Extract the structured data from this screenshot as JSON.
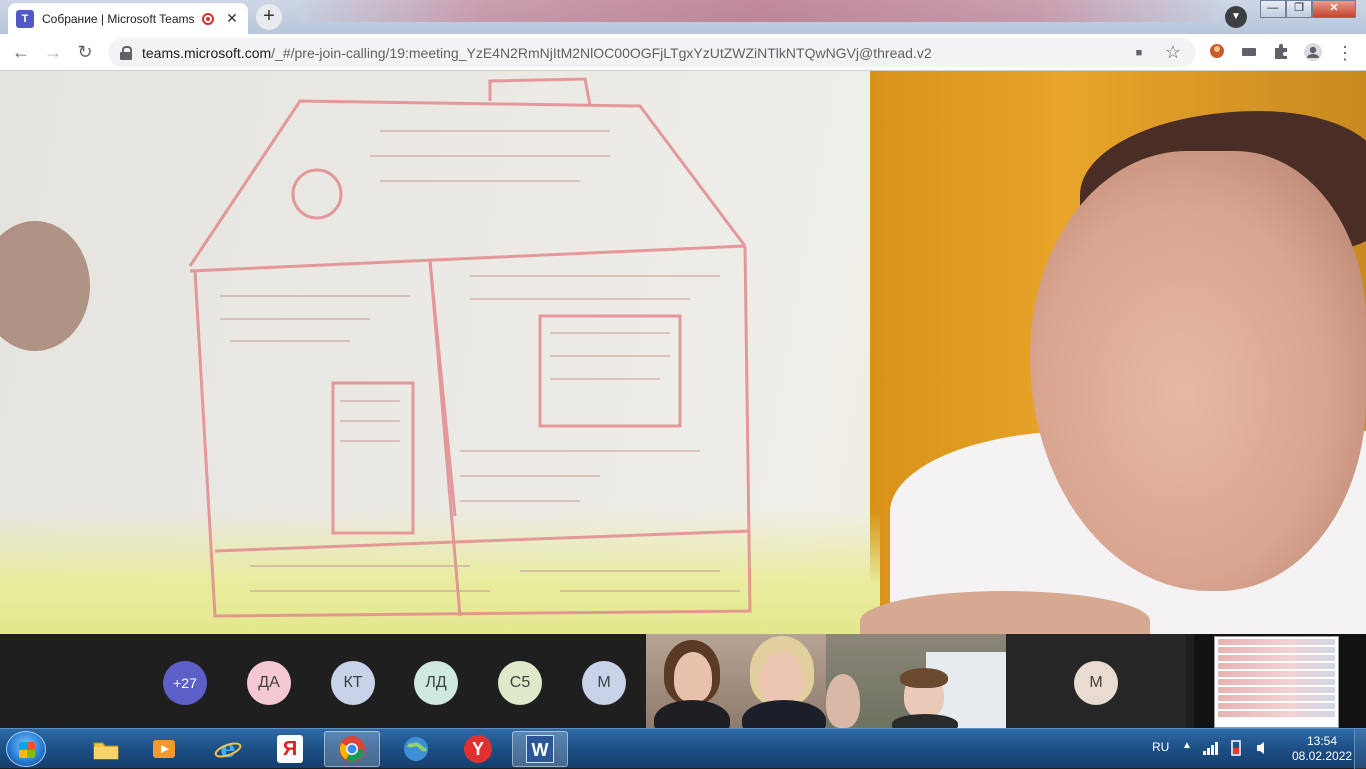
{
  "browser": {
    "tab_title": "Собрание | Microsoft Teams",
    "tab_close": "✕",
    "new_tab": "+",
    "url_host": "teams.microsoft.com",
    "url_path": "/_#/pre-join-calling/19:meeting_YzE4N2RmNjItM2NlOC00OGFjLTgxYzUtZWZiNTlkNTQwNGVj@thread.v2",
    "back": "←",
    "forward": "→",
    "reload": "↻",
    "star": "☆",
    "camera": "■",
    "minimize": "—",
    "maximize": "❐",
    "close": "✕"
  },
  "participants": {
    "overflow_count": "+27",
    "avatars": [
      "ДА",
      "КТ",
      "ЛД",
      "С5",
      "М"
    ],
    "tile_avatar": "М"
  },
  "taskbar": {
    "language": "RU",
    "time": "13:54",
    "date": "08.02.2022",
    "apps": [
      "explorer",
      "media-player",
      "internet-explorer",
      "yandex",
      "chrome",
      "network",
      "yandex-browser",
      "word"
    ],
    "word_label": "W",
    "yandex_label": "Я",
    "yandex_browser_label": "Y"
  },
  "colors": {
    "teams_purple": "#5b5fc7",
    "drawing_red": "#e05560",
    "taskbar_blue": "#1d4f85"
  }
}
